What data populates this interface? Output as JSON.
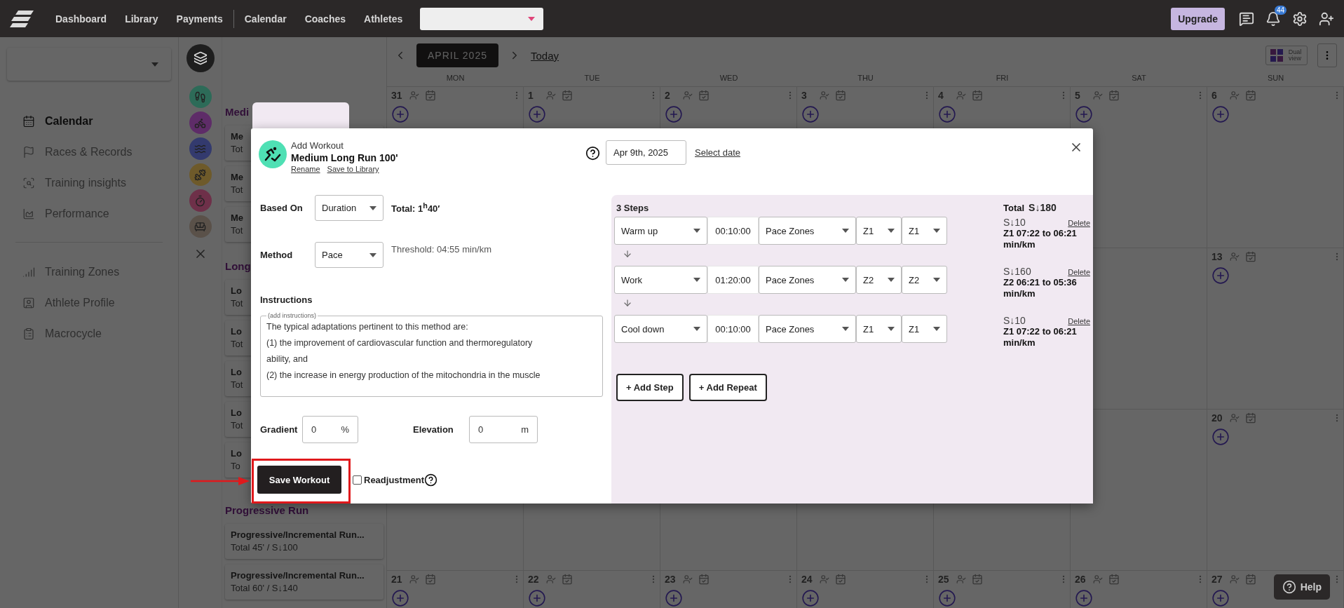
{
  "top_bar": {
    "nav_groups": [
      [
        "Dashboard",
        "Library",
        "Payments"
      ],
      [
        "Calendar",
        "Coaches",
        "Athletes"
      ]
    ],
    "upgrade": "Upgrade",
    "notifications": "44"
  },
  "sidebar": {
    "sections": [
      [
        {
          "label": "Calendar",
          "selected": true
        },
        {
          "label": "Races & Records",
          "selected": false
        },
        {
          "label": "Training insights",
          "selected": false
        },
        {
          "label": "Performance",
          "selected": false
        }
      ],
      [
        {
          "label": "Training Zones",
          "selected": false
        },
        {
          "label": "Athlete Profile",
          "selected": false
        },
        {
          "label": "Macrocycle",
          "selected": false
        }
      ]
    ]
  },
  "library": {
    "sports": [
      {
        "color": "#1e1e1e"
      },
      {
        "color": "#2d6b58"
      },
      {
        "color": "#5e2c68"
      },
      {
        "color": "#333a6e"
      },
      {
        "color": "#6e5a2a"
      },
      {
        "color": "#6e3049"
      },
      {
        "color": "#5a5149"
      }
    ],
    "groups": [
      {
        "title": "Medi",
        "cards": [
          {
            "title": "Me",
            "meta": "Tot"
          },
          {
            "title": "Me",
            "meta": "Tot"
          },
          {
            "title": "Me",
            "meta": "Tot"
          }
        ]
      },
      {
        "title": "Long",
        "cards": [
          {
            "title": "Lo",
            "meta": "Tot"
          },
          {
            "title": "Lo",
            "meta": "Tot"
          },
          {
            "title": "Lo",
            "meta": "Tot"
          },
          {
            "title": "Lo",
            "meta": "Tot"
          },
          {
            "title": "Lo",
            "meta": "To"
          }
        ]
      },
      {
        "title": "Progressive Run",
        "cards": [
          {
            "title": "Progressive/Incremental Run...",
            "meta": "Total 45' / S↓100"
          },
          {
            "title": "Progressive/Incremental Run...",
            "meta": "Total 60' / S↓140"
          }
        ]
      }
    ]
  },
  "calendar": {
    "month": "APRIL 2025",
    "today": "Today",
    "dual_view": "Dual view",
    "weekdays": [
      "MON",
      "TUE",
      "WED",
      "THU",
      "FRI",
      "SAT",
      "SUN"
    ],
    "weeks": [
      {
        "days": [
          {
            "day": "31"
          },
          {
            "day": "1"
          },
          {
            "day": "2"
          },
          {
            "day": "3"
          },
          {
            "day": "4"
          },
          {
            "day": "5"
          },
          {
            "day": "6"
          }
        ]
      },
      {
        "days": [
          {
            "day": "13"
          }
        ]
      },
      {
        "days": [
          {
            "day": "20"
          }
        ]
      },
      {
        "days": [
          {
            "day": "21"
          },
          {
            "day": "22"
          },
          {
            "day": "23"
          },
          {
            "day": "24"
          },
          {
            "day": "25"
          },
          {
            "day": "26"
          },
          {
            "day": "27"
          }
        ]
      }
    ]
  },
  "modal": {
    "heading": "Add Workout",
    "title": "Medium Long Run 100'",
    "links": [
      "Rename",
      "Save to Library"
    ],
    "date": "Apr 9th, 2025",
    "select_date": "Select date",
    "based_on": {
      "label": "Based On",
      "value": "Duration"
    },
    "total": "Total: 1$^{h}$40′",
    "method": {
      "label": "Method",
      "value": "Pace"
    },
    "threshold": "Threshold: 04:55 min/km",
    "instructions": {
      "label": "Instructions",
      "legend": "(add instructions)",
      "lines": [
        "The typical adaptations pertinent to this method are:",
        "(1) the improvement of cardiovascular function and thermoregulatory",
        "ability, and",
        "(2) the increase in energy production of the mitochondria in the muscle"
      ]
    },
    "gradient": {
      "label": "Gradient",
      "value": "0",
      "unit": "%"
    },
    "elevation": {
      "label": "Elevation",
      "value": "0",
      "unit": "m"
    },
    "save": "Save Workout",
    "readjustment": {
      "label": "Readjustment",
      "checked": false
    },
    "steps_title": "3 Steps",
    "total_score": {
      "label": "Total",
      "value": "S↓180"
    },
    "steps": [
      {
        "type": "Warm up",
        "duration": "00:10:00",
        "target": "Pace Zones",
        "zone_from": "Z1",
        "zone_to": "Z1",
        "score": "S↓10",
        "delete": "Delete",
        "range": "Z1 07:22 to 06:21 min/km"
      },
      {
        "type": "Work",
        "duration": "01:20:00",
        "target": "Pace Zones",
        "zone_from": "Z2",
        "zone_to": "Z2",
        "score": "S↓160",
        "delete": "Delete",
        "range": "Z2 06:21 to 05:36 min/km"
      },
      {
        "type": "Cool down",
        "duration": "00:10:00",
        "target": "Pace Zones",
        "zone_from": "Z1",
        "zone_to": "Z1",
        "score": "S↓10",
        "delete": "Delete",
        "range": "Z1 07:22 to 06:21 min/km"
      }
    ],
    "buttons": [
      "+ Add Step",
      "+ Add Repeat"
    ]
  },
  "help": "Help"
}
